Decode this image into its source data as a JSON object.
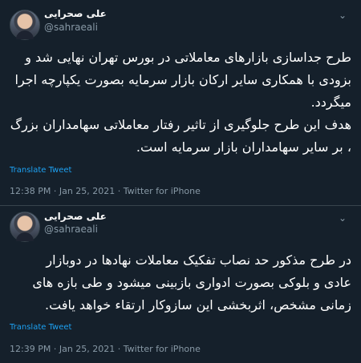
{
  "tweets": [
    {
      "author": {
        "name": "علی صحرایی",
        "handle": "@sahraeali"
      },
      "lines": [
        "طرح جداسازی بازارهای معاملاتی در بورس تهران نهایی شد و",
        "بزودی با همکاری سایر ارکان بازار سرمایه بصورت یکپارچه اجرا",
        "میگردد.",
        "هدف این طرح جلوگیری از تاثیر رفتار معاملاتی سهامداران بزرگ",
        "، بر سایر سهامداران بازار سرمایه است."
      ],
      "translate_label": "Translate Tweet",
      "time": "12:38 PM",
      "date": "Jan 25, 2021",
      "source": "Twitter for iPhone"
    },
    {
      "author": {
        "name": "علی صحرایی",
        "handle": "@sahraeali"
      },
      "lines": [
        "در طرح مذکور حد نصاب تفکیک معاملات نهادها در دوبازار",
        "عادی و بلوکی بصورت ادواری بازبینی میشود و طی بازه های",
        "زمانی مشخص، اثربخشی این سازوکار ارتقاء خواهد یافت."
      ],
      "translate_label": "Translate Tweet",
      "time": "12:39 PM",
      "date": "Jan 25, 2021",
      "source": "Twitter for iPhone"
    }
  ],
  "meta_separator": "·",
  "icons": {
    "more": "chevron-down-icon"
  },
  "colors": {
    "background": "#15202b",
    "text": "#ffffff",
    "muted": "#8899a6",
    "link": "#1da1f2",
    "divider": "#38444d"
  }
}
